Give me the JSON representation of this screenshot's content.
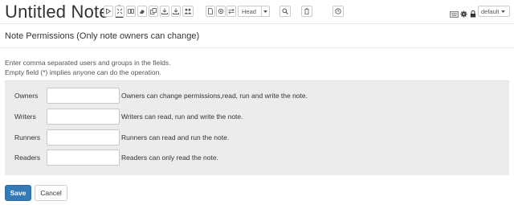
{
  "header": {
    "title": "Untitled Note 1",
    "toolbar_icons": [
      "play-icon",
      "hide-code-icon",
      "hide-output-icon",
      "clear-output-icon",
      "clone-icon",
      "export-icon",
      "export-alt-icon",
      "users-icon",
      "version-icon",
      "commit-icon",
      "compare-icon",
      "search-icon",
      "trash-icon",
      "schedule-icon"
    ],
    "head_label": "Head",
    "right_icons": [
      "keyboard-icon",
      "gear-icon",
      "lock-icon"
    ],
    "interpreter_binding": "default"
  },
  "permissions": {
    "title": "Note Permissions (Only note owners can change)",
    "instructions": [
      "Enter comma separated users and groups in the fields.",
      "Empty field (*) implies anyone can do the operation."
    ],
    "rows": [
      {
        "label": "Owners",
        "value": "",
        "description": "Owners can change permissions,read, run and write the note."
      },
      {
        "label": "Writers",
        "value": "",
        "description": "Writers can read, run and write the note."
      },
      {
        "label": "Runners",
        "value": "",
        "description": "Runners can read and run the note."
      },
      {
        "label": "Readers",
        "value": "",
        "description": "Readers can only read the note."
      }
    ],
    "save_label": "Save",
    "cancel_label": "Cancel"
  },
  "colors": {
    "save_button": "#337ab7",
    "panel_background": "#ececec"
  }
}
